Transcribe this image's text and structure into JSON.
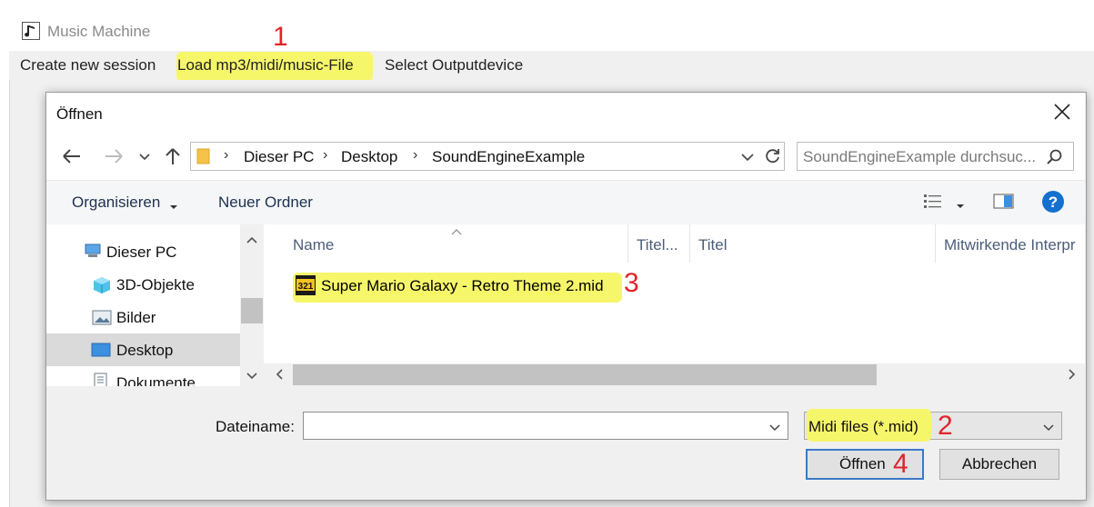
{
  "app": {
    "title": "Music Machine",
    "menu": [
      "Create new session",
      "Load mp3/midi/music-File",
      "Select Outputdevice"
    ]
  },
  "dialog": {
    "title": "Öffnen",
    "address": [
      "Dieser PC",
      "Desktop",
      "SoundEngineExample"
    ],
    "search_placeholder": "SoundEngineExample durchsuc...",
    "toolbar": {
      "organize": "Organisieren",
      "new_folder": "Neuer Ordner"
    },
    "tree": [
      "Dieser PC",
      "3D-Objekte",
      "Bilder",
      "Desktop",
      "Dokumente"
    ],
    "tree_selected": "Desktop",
    "columns": [
      "Name",
      "Titel...",
      "Titel",
      "Mitwirkende Interpr"
    ],
    "files": [
      {
        "name": "Super Mario Galaxy - Retro Theme 2.mid"
      }
    ],
    "filename_label": "Dateiname:",
    "filename_value": "",
    "filetype": "Midi files (*.mid)",
    "open_label": "Öffnen",
    "cancel_label": "Abbrechen"
  },
  "annotations": [
    "1",
    "2",
    "3",
    "4"
  ],
  "colors": {
    "highlight": "#f6f66a",
    "annotation": "#e0242a",
    "help": "#1470d0"
  }
}
